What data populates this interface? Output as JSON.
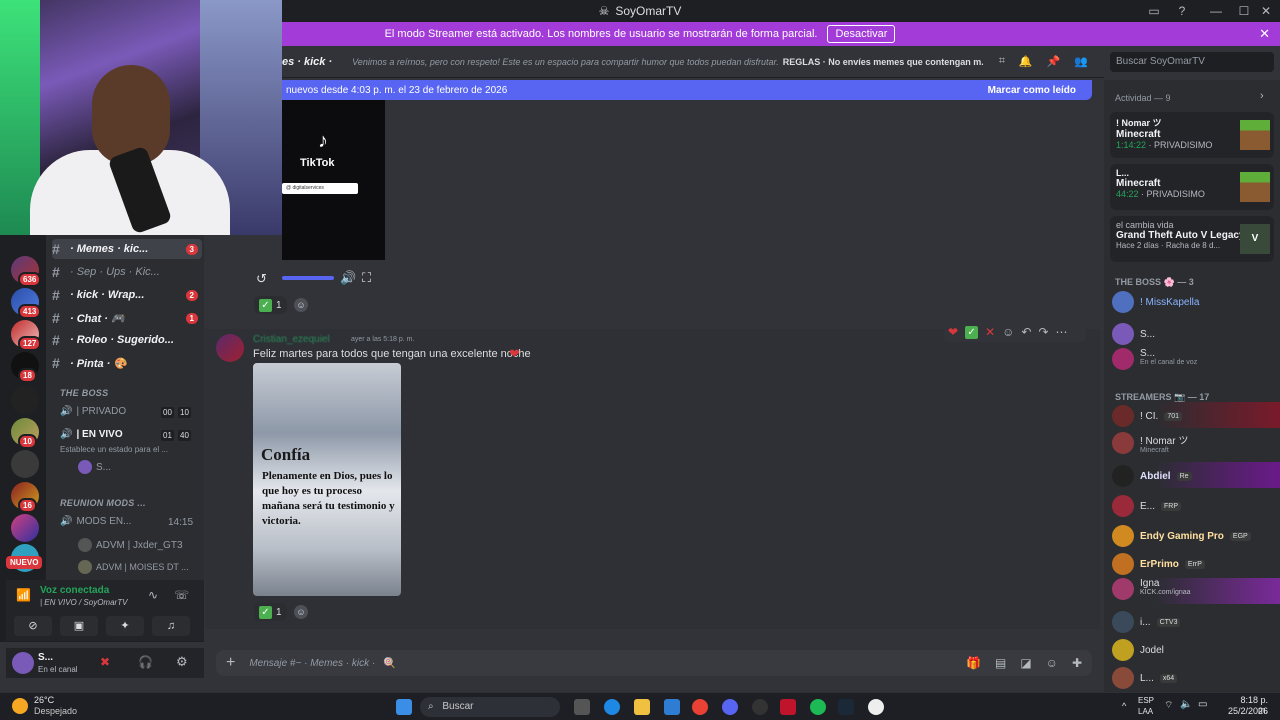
{
  "window": {
    "title": "SoyOmarTV"
  },
  "streamer_banner": {
    "text": "El modo Streamer está activado. Los nombres de usuario se mostrarán de forma parcial.",
    "button": "Desactivar"
  },
  "rail": {
    "badges": [
      "636",
      "413",
      "127",
      "18",
      "10",
      "16"
    ],
    "nuevo": "NUEVO"
  },
  "channels": {
    "text": [
      {
        "name": "· Memes · kic...",
        "badge": "3"
      },
      {
        "name": "· Sep · Ups · Kic...",
        "badge": ""
      },
      {
        "name": "· kick · Wrap...",
        "badge": "2"
      },
      {
        "name": "· Chat · 🎮",
        "badge": "1"
      },
      {
        "name": "· Roleo · Sugerido...",
        "badge": ""
      },
      {
        "name": "· Pinta · 🎨",
        "badge": ""
      }
    ],
    "cat_boss": "THE BOSS",
    "privado": "| PRIVADO",
    "privado_counts": [
      "00",
      "10"
    ],
    "envivo": "| EN VIVO",
    "envivo_counts": [
      "01",
      "40"
    ],
    "status_hint": "Establece un estado para el ...",
    "voice_user": "S...",
    "cat_reunion": "REUNION MODS ...",
    "mods": "MODS EN...",
    "mods_time": "14:15",
    "advm1": "ADVM | Jxder_GT3",
    "advm2": "ADVM | MOISES DT ..."
  },
  "voice": {
    "status": "Voz conectada",
    "channel": "| EN VIVO / SoyOmarTV"
  },
  "user": {
    "name": "S...",
    "status": "En el canal"
  },
  "header": {
    "channel": "es · kick ·",
    "topic": "Venimos a reírnos, pero con respeto! Este es un espacio para compartir humor que todos puedan disfrutar.",
    "rules": "REGLAS · No envíes memes que contengan m...",
    "search_placeholder": "Buscar SoyOmarTV"
  },
  "new_messages": {
    "text": "nuevos desde 4:03 p. m. el 23 de febrero de 2026",
    "mark": "Marcar como leído"
  },
  "tiktok": {
    "label": "TikTok",
    "handle": "@ digitalservices"
  },
  "messages": [
    {
      "reaction_count": "1"
    },
    {
      "author": "Cristian_ezequiel",
      "time": "ayer a las 5:18 p. m.",
      "text": "Feliz martes para todos que tengan una excelente noche",
      "image_title": "Confía",
      "image_text": "Plenamente en Dios, pues lo que hoy es tu proceso mañana será tu testimonio y victoria.",
      "reaction_count": "1"
    }
  ],
  "composer": {
    "placeholder": "Mensaje #~ · Memes · kick ·"
  },
  "activity": {
    "title": "Actividad — 9",
    "cards": [
      {
        "user": "! Nomar ツ",
        "game": "Minecraft",
        "time": "1:14:22",
        "channel": "PRIVADISIMO"
      },
      {
        "user": "L...",
        "game": "Minecraft",
        "time": "44:22",
        "channel": "PRIVADISIMO"
      },
      {
        "user": "el cambia vida",
        "game": "Grand Theft Auto V Legacy",
        "time": "Hace 2 días",
        "channel": "Racha de 8 d..."
      }
    ]
  },
  "members": {
    "boss_header": "THE BOSS 🌸 — 3",
    "boss": [
      {
        "name": "! MissKapella",
        "sub": ""
      },
      {
        "name": "S...",
        "sub": ""
      },
      {
        "name": "S...",
        "sub": "En el canal de voz"
      }
    ],
    "streamers_header": "STREAMERS 📷 — 17",
    "streamers": [
      {
        "name": "! CI.",
        "sub": "",
        "tag": "701"
      },
      {
        "name": "! Nomar ツ",
        "sub": "Minecraft",
        "tag": ""
      },
      {
        "name": "Abdiel",
        "sub": "",
        "tag": "Re"
      },
      {
        "name": "E...",
        "sub": "",
        "tag": "FRP"
      },
      {
        "name": "Endy Gaming Pro",
        "sub": "",
        "tag": "EGP"
      },
      {
        "name": "ErPrimo",
        "sub": "",
        "tag": "ErrP"
      },
      {
        "name": "Igna",
        "sub": "KICK.com/ignaa",
        "tag": ""
      },
      {
        "name": "i...",
        "sub": "",
        "tag": "CTV3"
      },
      {
        "name": "Jodel",
        "sub": "",
        "tag": ""
      },
      {
        "name": "L...",
        "sub": "",
        "tag": "x64"
      }
    ]
  },
  "taskbar": {
    "weather_temp": "26°C",
    "weather_desc": "Despejado",
    "search": "Buscar",
    "lang1": "ESP",
    "lang2": "LAA",
    "time": "8:18 p. m.",
    "date": "25/2/2026"
  },
  "colors": {
    "accent": "#5865f2",
    "streamer": "#a23bd8",
    "badge": "#da373c"
  }
}
